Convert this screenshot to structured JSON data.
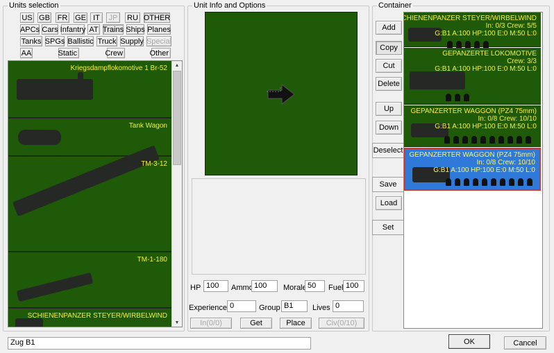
{
  "units_selection": {
    "title": "Units selection",
    "filters_row1": [
      "US",
      "GB",
      "FR",
      "GE",
      "IT",
      "JP",
      "RU",
      "OTHER"
    ],
    "filters_row2": [
      "APCs",
      "Cars",
      "Infantry",
      "AT",
      "Trains",
      "Ships",
      "Planes"
    ],
    "filters_row3": [
      "Tanks",
      "SPGs",
      "Ballistic",
      "Truck",
      "Supply",
      "Special"
    ],
    "filters_row4": [
      "AA",
      "Static",
      "Crew",
      "Other"
    ],
    "units": [
      "Kriegsdampflokomotive 1 Br-52",
      "Tank Wagon",
      "TM-3-12",
      "TM-1-180",
      "SCHIENENPANZER STEYER/WIRBELWIND"
    ]
  },
  "unit_info": {
    "title": "Unit Info and Options",
    "hp_label": "HP",
    "hp": "100",
    "ammo_label": "Ammo",
    "ammo": "100",
    "morale_label": "Morale",
    "morale": "50",
    "fuel_label": "Fuel",
    "fuel": "100",
    "experience_label": "Experience",
    "experience": "0",
    "group_label": "Group",
    "group": "B1",
    "lives_label": "Lives",
    "lives": "0",
    "in_label": "In(0/0)",
    "get_label": "Get",
    "place_label": "Place",
    "civ_label": "Civ(0/10)"
  },
  "actions": {
    "add": "Add",
    "copy": "Copy",
    "cut": "Cut",
    "delete": "Delete",
    "up": "Up",
    "down": "Down",
    "deselect": "Deselect",
    "save": "Save",
    "load": "Load",
    "set": "Set"
  },
  "container": {
    "title": "Container",
    "items": [
      {
        "title": "SCHIENENPANZER STEYER/WIRBELWIND",
        "line1": "In: 0/3 Crew: 5/5",
        "line2": "G:B1 A:100 HP:100 E:0 M:50 L:0",
        "crew": 5
      },
      {
        "title": "GEPANZERTE LOKOMOTIVE",
        "line1": "Crew: 3/3",
        "line2": "G:B1 A:100 HP:100 E:0 M:50 L:0",
        "crew": 3
      },
      {
        "title": "GEPANZERTER WAGGON (PZ4 75mm)",
        "line1": "In: 0/8 Crew: 10/10",
        "line2": "G:B1 A:100 HP:100 E:0 M:50 L:0",
        "crew": 10
      },
      {
        "title": "GEPANZERTER WAGGON (PZ4 75mm)",
        "line1": "In: 0/8 Crew: 10/10",
        "line2": "G:B1 A:100 HP:100 E:0 M:50 L:0",
        "crew": 10
      }
    ]
  },
  "bottom": {
    "name_value": "Zug B1",
    "ok": "OK",
    "cancel": "Cancel"
  }
}
